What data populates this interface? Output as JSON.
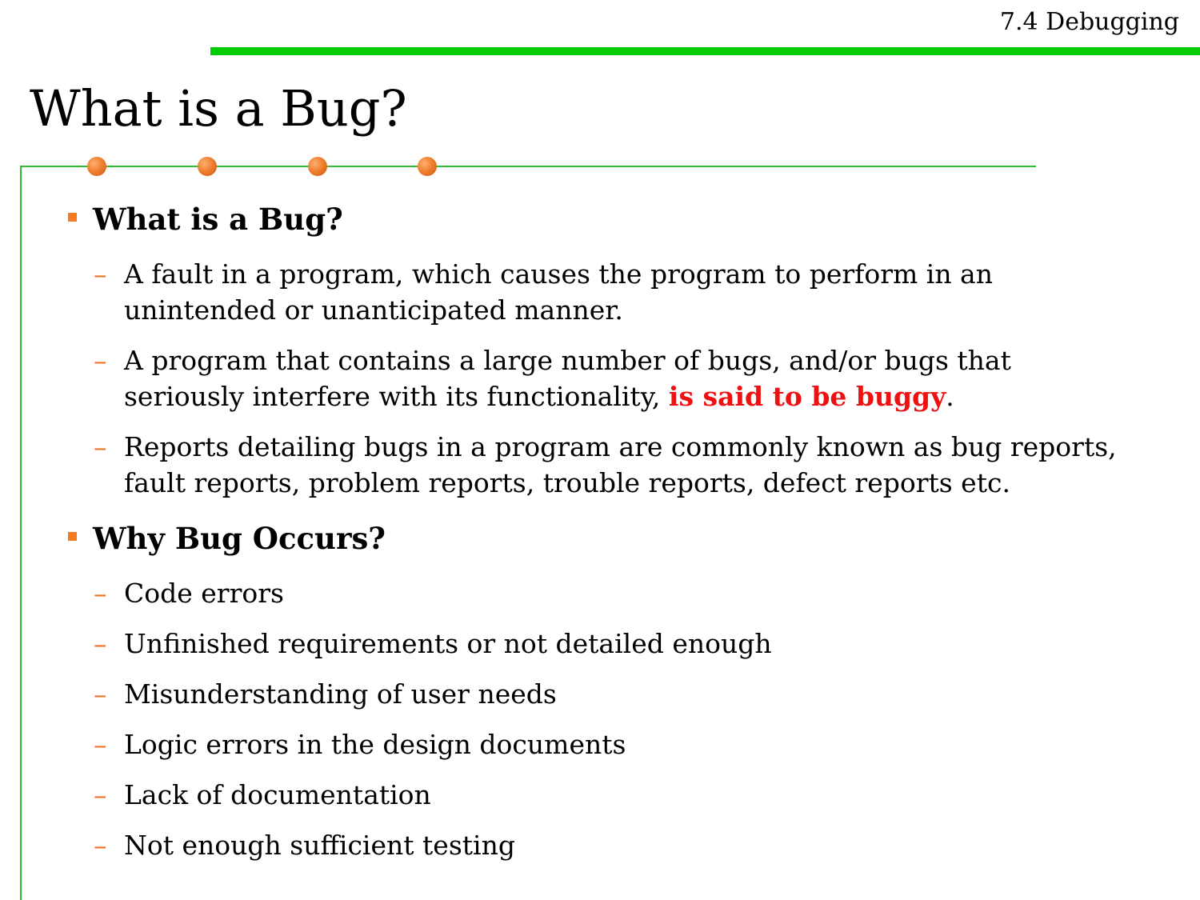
{
  "header": {
    "section_label": "7.4 Debugging",
    "title": "What is a Bug?"
  },
  "sections": [
    {
      "heading": "What is a Bug?",
      "items": [
        {
          "line1": "A fault in a program, which causes the program to perform in an",
          "line2": "unintended or unanticipated manner."
        },
        {
          "line1": "A program that contains a large number of bugs, and/or bugs that",
          "line2_prefix": "seriously interfere with its functionality, ",
          "line2_emphasis": "is said to be buggy",
          "line2_suffix": "."
        },
        {
          "line1": "Reports detailing bugs in a program are commonly known as bug reports,",
          "line2": "fault reports, problem reports, trouble reports, defect reports etc."
        }
      ]
    },
    {
      "heading": "Why Bug Occurs?",
      "items": [
        "Code errors",
        "Unfinished requirements or not detailed enough",
        "Misunderstanding of user needs",
        "Logic errors in the design documents",
        "Lack of documentation",
        "Not enough sufficient testing"
      ]
    }
  ],
  "symbols": {
    "dash": "–"
  },
  "colors": {
    "accent_green": "#00cc00",
    "frame_green": "#33bb33",
    "bullet_orange": "#f47b20",
    "emphasis_red": "#ee1111"
  }
}
